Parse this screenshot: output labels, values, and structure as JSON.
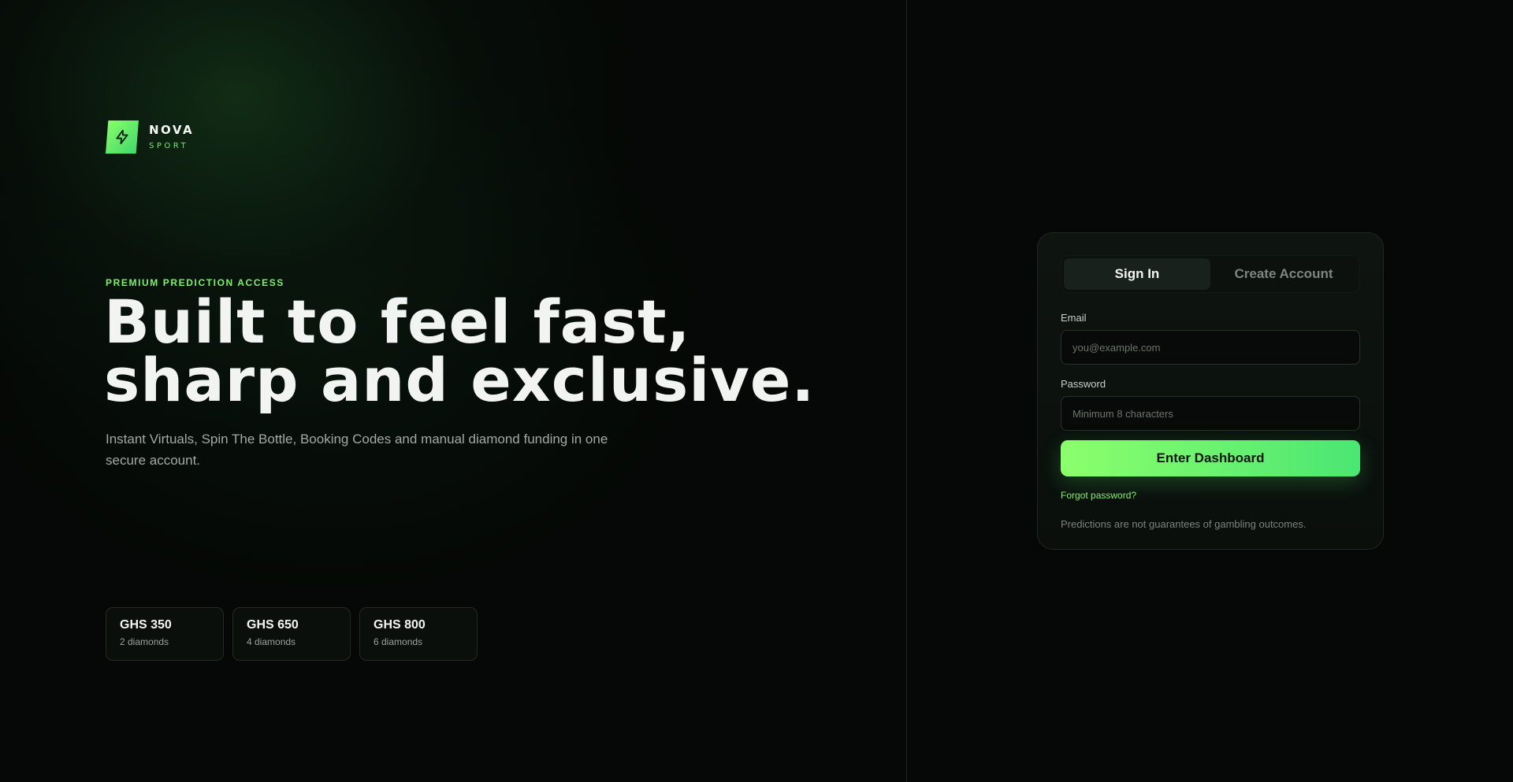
{
  "brand": {
    "name": "NOVA",
    "subtitle": "SPORT",
    "icon": "lightning-bolt-icon",
    "accent_color": "#74e86a"
  },
  "hero": {
    "eyebrow": "PREMIUM PREDICTION ACCESS",
    "headline_line1": "Built to feel fast,",
    "headline_line2": "sharp and exclusive.",
    "description": "Instant Virtuals, Spin The Bottle, Booking Codes and manual diamond funding in one secure account."
  },
  "tiers": [
    {
      "price": "GHS 350",
      "diamonds": "2 diamonds"
    },
    {
      "price": "GHS 650",
      "diamonds": "4 diamonds"
    },
    {
      "price": "GHS 800",
      "diamonds": "6 diamonds"
    }
  ],
  "auth": {
    "tabs": [
      {
        "label": "Sign In",
        "active": true
      },
      {
        "label": "Create Account",
        "active": false
      }
    ],
    "email_label": "Email",
    "email_placeholder": "you@example.com",
    "email_value": "",
    "password_label": "Password",
    "password_placeholder": "Minimum 8 characters",
    "password_value": "",
    "submit_label": "Enter Dashboard",
    "forgot_label": "Forgot password?",
    "disclaimer": "Predictions are not guarantees of gambling outcomes.",
    "button_gradient": [
      "#8cff6c",
      "#4be673"
    ]
  }
}
